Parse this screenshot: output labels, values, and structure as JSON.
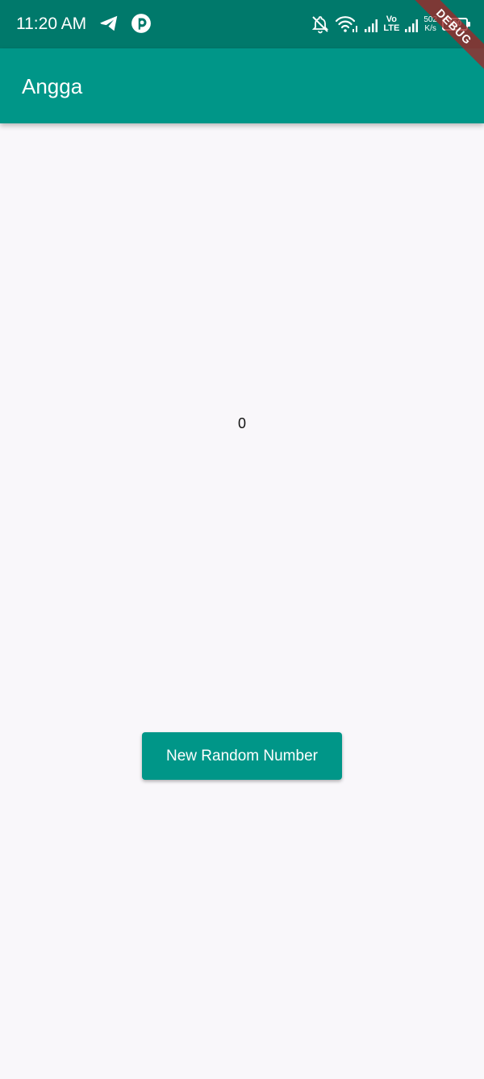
{
  "status_bar": {
    "time": "11:20 AM",
    "left_icons": [
      "telegram-icon",
      "app-notification-icon"
    ],
    "right_icons": [
      "bell-off-icon",
      "wifi-icon",
      "signal-icon"
    ],
    "volte_top": "Vo",
    "volte_bottom": "LTE",
    "speed_value": "502",
    "speed_unit": "K/s",
    "battery": "100"
  },
  "debug_banner": "DEBUG",
  "app_bar": {
    "title": "Angga"
  },
  "main": {
    "counter_value": "0",
    "button_label": "New Random Number"
  },
  "colors": {
    "status_bar": "#00796b",
    "primary": "#009688",
    "background": "#f9f7fa"
  }
}
